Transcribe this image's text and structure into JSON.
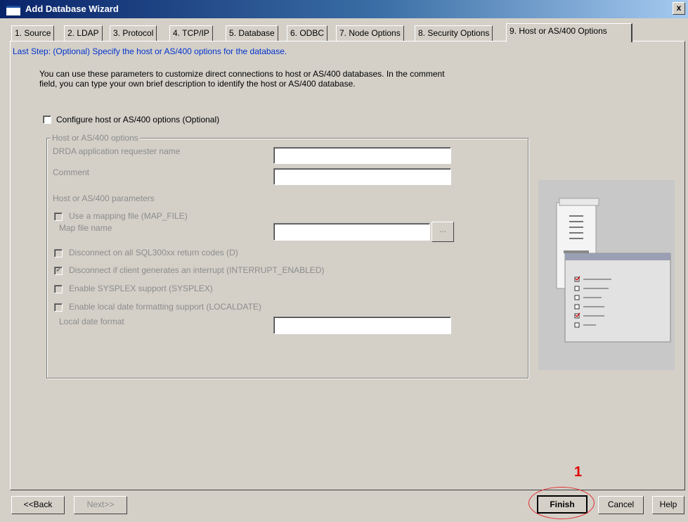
{
  "window": {
    "title": "Add Database Wizard",
    "close_glyph": "x"
  },
  "tabs": [
    {
      "label": "1. Source"
    },
    {
      "label": "2. LDAP"
    },
    {
      "label": "3. Protocol"
    },
    {
      "label": "4. TCP/IP"
    },
    {
      "label": "5. Database"
    },
    {
      "label": "6. ODBC"
    },
    {
      "label": "7. Node Options"
    },
    {
      "label": "8. Security Options"
    },
    {
      "label": "9. Host or AS/400 Options",
      "active": true
    }
  ],
  "page": {
    "last_step": "Last Step: (Optional) Specify the host or AS/400 options for the database.",
    "description_line1": "You can use these parameters to customize direct connections to host or AS/400 databases.   In the comment",
    "description_line2": "field, you can type your own brief description to identify the host or AS/400 database.",
    "configure_label": "Configure host or AS/400 options (Optional)",
    "configure_checked": false
  },
  "group": {
    "legend": "Host or AS/400 options",
    "drda_label": "DRDA application requester name",
    "drda_value": "",
    "comment_label": "Comment",
    "comment_value": "",
    "params_label": "Host or AS/400 parameters",
    "mapping_file_label": "Use a mapping file (MAP_FILE)",
    "mapping_file_checked": false,
    "map_file_name_label": "Map file name",
    "map_file_value": "",
    "browse_label": "...",
    "disconnect_all_label": "Disconnect on all SQL300xx return codes (D)",
    "disconnect_all_checked": false,
    "disconnect_interrupt_label": "Disconnect if client generates an interrupt (INTERRUPT_ENABLED)",
    "disconnect_interrupt_checked": true,
    "sysplex_label": "Enable SYSPLEX support (SYSPLEX)",
    "sysplex_checked": false,
    "localdate_label": "Enable local date formatting support (LOCALDATE)",
    "localdate_checked": false,
    "local_date_format_label": "Local date format",
    "local_date_format_value": ""
  },
  "buttons": {
    "back": "<<Back",
    "next": "Next>>",
    "finish": "Finish",
    "cancel": "Cancel",
    "help": "Help"
  },
  "annotation": {
    "number": "1",
    "color": "#e00000"
  }
}
